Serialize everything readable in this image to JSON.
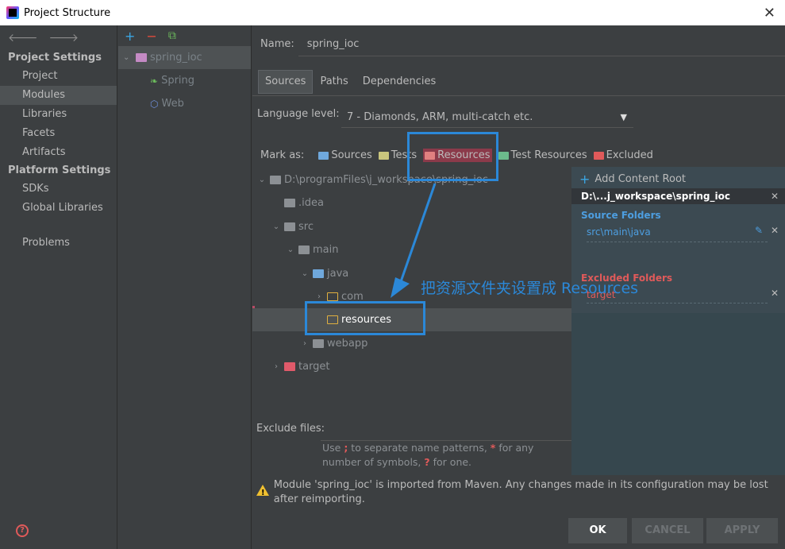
{
  "window": {
    "title": "Project Structure"
  },
  "nav": {
    "project_settings_head": "Project Settings",
    "project_settings": [
      "Project",
      "Modules",
      "Libraries",
      "Facets",
      "Artifacts"
    ],
    "platform_settings_head": "Platform Settings",
    "platform_settings": [
      "SDKs",
      "Global Libraries"
    ],
    "problems": "Problems"
  },
  "modules": {
    "items": [
      {
        "label": "spring_ioc",
        "icon": "module-folder-icon"
      },
      {
        "label": "Spring",
        "icon": "spring-leaf-icon"
      },
      {
        "label": "Web",
        "icon": "web-icon"
      }
    ]
  },
  "detail": {
    "name_label": "Name:",
    "name_value": "spring_ioc",
    "tabs": [
      "Sources",
      "Paths",
      "Dependencies"
    ],
    "language_label": "Language level:",
    "language_value": "7 - Diamonds, ARM, multi-catch etc.",
    "mark_as_label": "Mark as:",
    "marks": [
      "Sources",
      "Tests",
      "Resources",
      "Test Resources",
      "Excluded"
    ],
    "tree": [
      "D:\\programFiles\\j_workspace\\spring_ioc",
      ".idea",
      "src",
      "main",
      "java",
      "com",
      "resources",
      "webapp",
      "target"
    ],
    "exclude_files_label": "Exclude files:",
    "hint_a": "Use ",
    "hint_semicolon": ";",
    "hint_b": " to separate name patterns, ",
    "hint_star": "*",
    "hint_c": " for any number of symbols, ",
    "hint_q": "?",
    "hint_d": " for one.",
    "warning": "Module 'spring_ioc' is imported from Maven. Any changes made in its configuration may be lost after reimporting."
  },
  "roots": {
    "add_label": "Add Content Root",
    "root_path": "D:\\...j_workspace\\spring_ioc",
    "source_head": "Source Folders",
    "source_path": "src\\main\\java",
    "excluded_head": "Excluded Folders",
    "excluded_path": "target"
  },
  "buttons": {
    "ok": "OK",
    "cancel": "CANCEL",
    "apply": "APPLY"
  },
  "annotation": {
    "text": "把资源文件夹设置成 Resources"
  }
}
